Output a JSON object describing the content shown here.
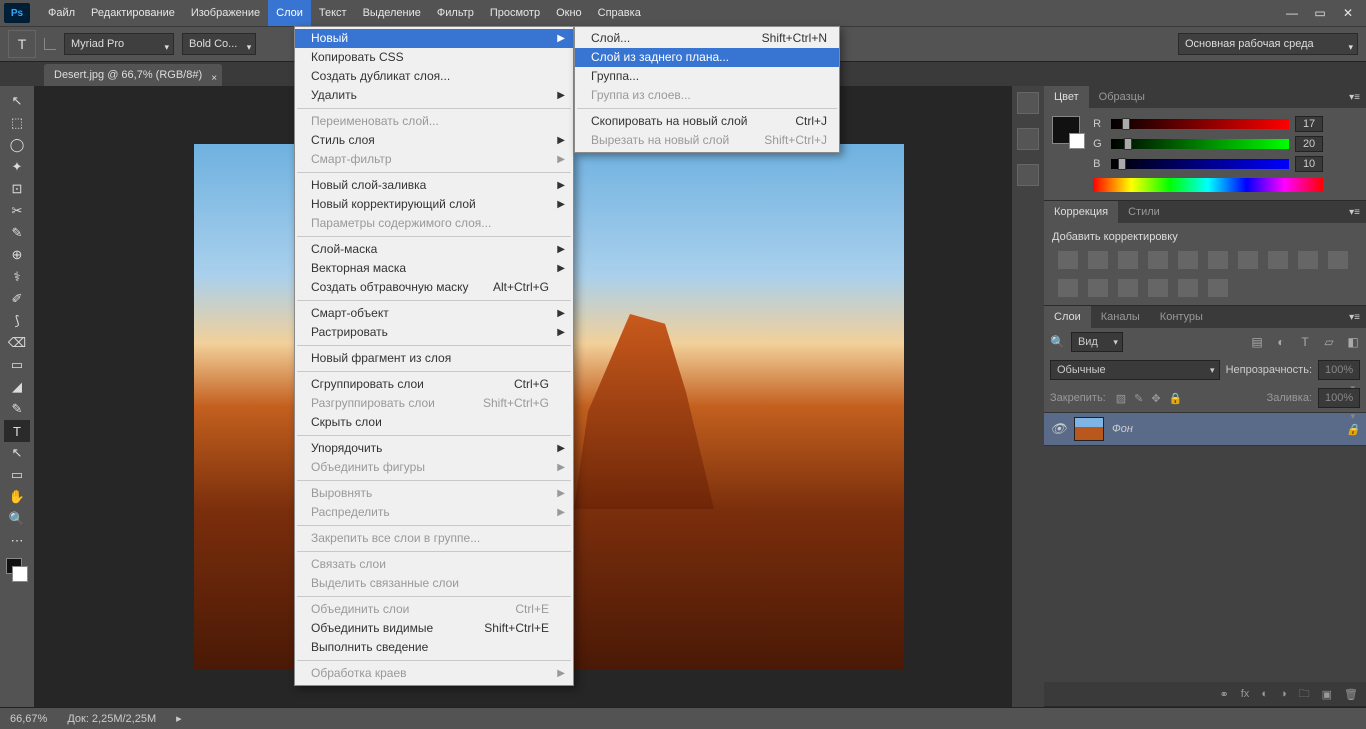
{
  "menubar": {
    "items": [
      "Файл",
      "Редактирование",
      "Изображение",
      "Слои",
      "Текст",
      "Выделение",
      "Фильтр",
      "Просмотр",
      "Окно",
      "Справка"
    ],
    "active_index": 3
  },
  "optbar": {
    "tool_letter": "T",
    "font": "Myriad Pro",
    "weight": "Bold Co...",
    "workspace": "Основная рабочая среда"
  },
  "doc_tab": {
    "title": "Desert.jpg @ 66,7% (RGB/8#)"
  },
  "status": {
    "zoom": "66,67%",
    "doc": "Док: 2,25M/2,25M"
  },
  "color_panel": {
    "tabs": [
      "Цвет",
      "Образцы"
    ],
    "r_label": "R",
    "g_label": "G",
    "b_label": "B",
    "r": "17",
    "g": "20",
    "b": "10"
  },
  "adjust_panel": {
    "tabs": [
      "Коррекция",
      "Стили"
    ],
    "title": "Добавить корректировку"
  },
  "layers_panel": {
    "tabs": [
      "Слои",
      "Каналы",
      "Контуры"
    ],
    "kind_label": "Вид",
    "blend": "Обычные",
    "opacity_label": "Непрозрачность:",
    "opacity_val": "100%",
    "lock_label": "Закрепить:",
    "fill_label": "Заливка:",
    "fill_val": "100%",
    "layer_name": "Фон"
  },
  "menu_layers": [
    {
      "t": "Новый",
      "arr": true,
      "hi": true
    },
    {
      "t": "Копировать CSS"
    },
    {
      "t": "Создать дубликат слоя..."
    },
    {
      "t": "Удалить",
      "arr": true
    },
    {
      "sep": true
    },
    {
      "t": "Переименовать слой...",
      "dis": true
    },
    {
      "t": "Стиль слоя",
      "arr": true
    },
    {
      "t": "Смарт-фильтр",
      "arr": true,
      "dis": true
    },
    {
      "sep": true
    },
    {
      "t": "Новый слой-заливка",
      "arr": true
    },
    {
      "t": "Новый корректирующий слой",
      "arr": true
    },
    {
      "t": "Параметры содержимого слоя...",
      "dis": true
    },
    {
      "sep": true
    },
    {
      "t": "Слой-маска",
      "arr": true
    },
    {
      "t": "Векторная маска",
      "arr": true
    },
    {
      "t": "Создать обтравочную маску",
      "sc": "Alt+Ctrl+G"
    },
    {
      "sep": true
    },
    {
      "t": "Смарт-объект",
      "arr": true
    },
    {
      "t": "Растрировать",
      "arr": true
    },
    {
      "sep": true
    },
    {
      "t": "Новый фрагмент из слоя"
    },
    {
      "sep": true
    },
    {
      "t": "Сгруппировать слои",
      "sc": "Ctrl+G"
    },
    {
      "t": "Разгруппировать слои",
      "sc": "Shift+Ctrl+G",
      "dis": true
    },
    {
      "t": "Скрыть слои"
    },
    {
      "sep": true
    },
    {
      "t": "Упорядочить",
      "arr": true
    },
    {
      "t": "Объединить фигуры",
      "arr": true,
      "dis": true
    },
    {
      "sep": true
    },
    {
      "t": "Выровнять",
      "arr": true,
      "dis": true
    },
    {
      "t": "Распределить",
      "arr": true,
      "dis": true
    },
    {
      "sep": true
    },
    {
      "t": "Закрепить все слои в группе...",
      "dis": true
    },
    {
      "sep": true
    },
    {
      "t": "Связать слои",
      "dis": true
    },
    {
      "t": "Выделить связанные слои",
      "dis": true
    },
    {
      "sep": true
    },
    {
      "t": "Объединить слои",
      "sc": "Ctrl+E",
      "dis": true
    },
    {
      "t": "Объединить видимые",
      "sc": "Shift+Ctrl+E"
    },
    {
      "t": "Выполнить сведение"
    },
    {
      "sep": true
    },
    {
      "t": "Обработка краев",
      "arr": true,
      "dis": true
    }
  ],
  "menu_new": [
    {
      "t": "Слой...",
      "sc": "Shift+Ctrl+N"
    },
    {
      "t": "Слой из заднего плана...",
      "hi": true
    },
    {
      "t": "Группа..."
    },
    {
      "t": "Группа из слоев...",
      "dis": true
    },
    {
      "sep": true
    },
    {
      "t": "Скопировать на новый слой",
      "sc": "Ctrl+J"
    },
    {
      "t": "Вырезать на новый слой",
      "sc": "Shift+Ctrl+J",
      "dis": true
    }
  ],
  "tools": [
    "↖",
    "⬚",
    "◯",
    "✦",
    "⊡",
    "✂",
    "✎",
    "⊕",
    "⚕",
    "✐",
    "⟆",
    "⌫",
    "▭",
    "◢",
    "✎",
    "T",
    "↖",
    "▭",
    "✋",
    "🔍",
    "⋯"
  ]
}
